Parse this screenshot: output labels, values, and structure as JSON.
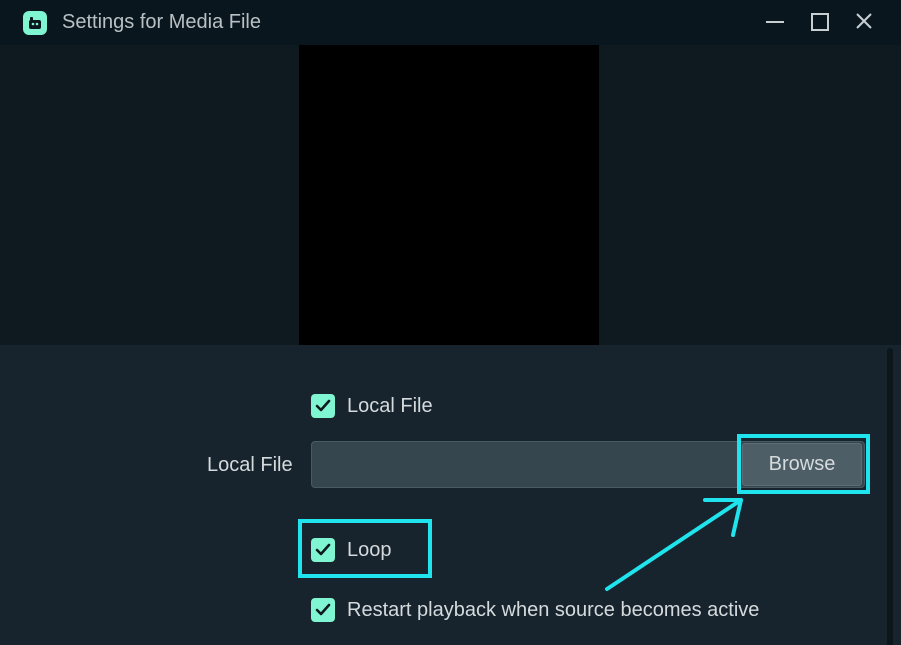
{
  "window": {
    "title": "Settings for Media File",
    "icon": "app-logo-icon",
    "controls": [
      "minimize-icon",
      "maximize-icon",
      "close-icon"
    ]
  },
  "settings": {
    "local_file_checkbox": {
      "label": "Local File",
      "checked": true
    },
    "local_file_field": {
      "label": "Local File",
      "value": "",
      "browse_label": "Browse"
    },
    "loop_checkbox": {
      "label": "Loop",
      "checked": true
    },
    "restart_checkbox": {
      "label": "Restart playback when source becomes active",
      "checked": true
    }
  },
  "colors": {
    "accent": "#80f5d2",
    "annotation": "#1fe4ed",
    "titlebar": "#09161d",
    "panel": "#17242d"
  }
}
